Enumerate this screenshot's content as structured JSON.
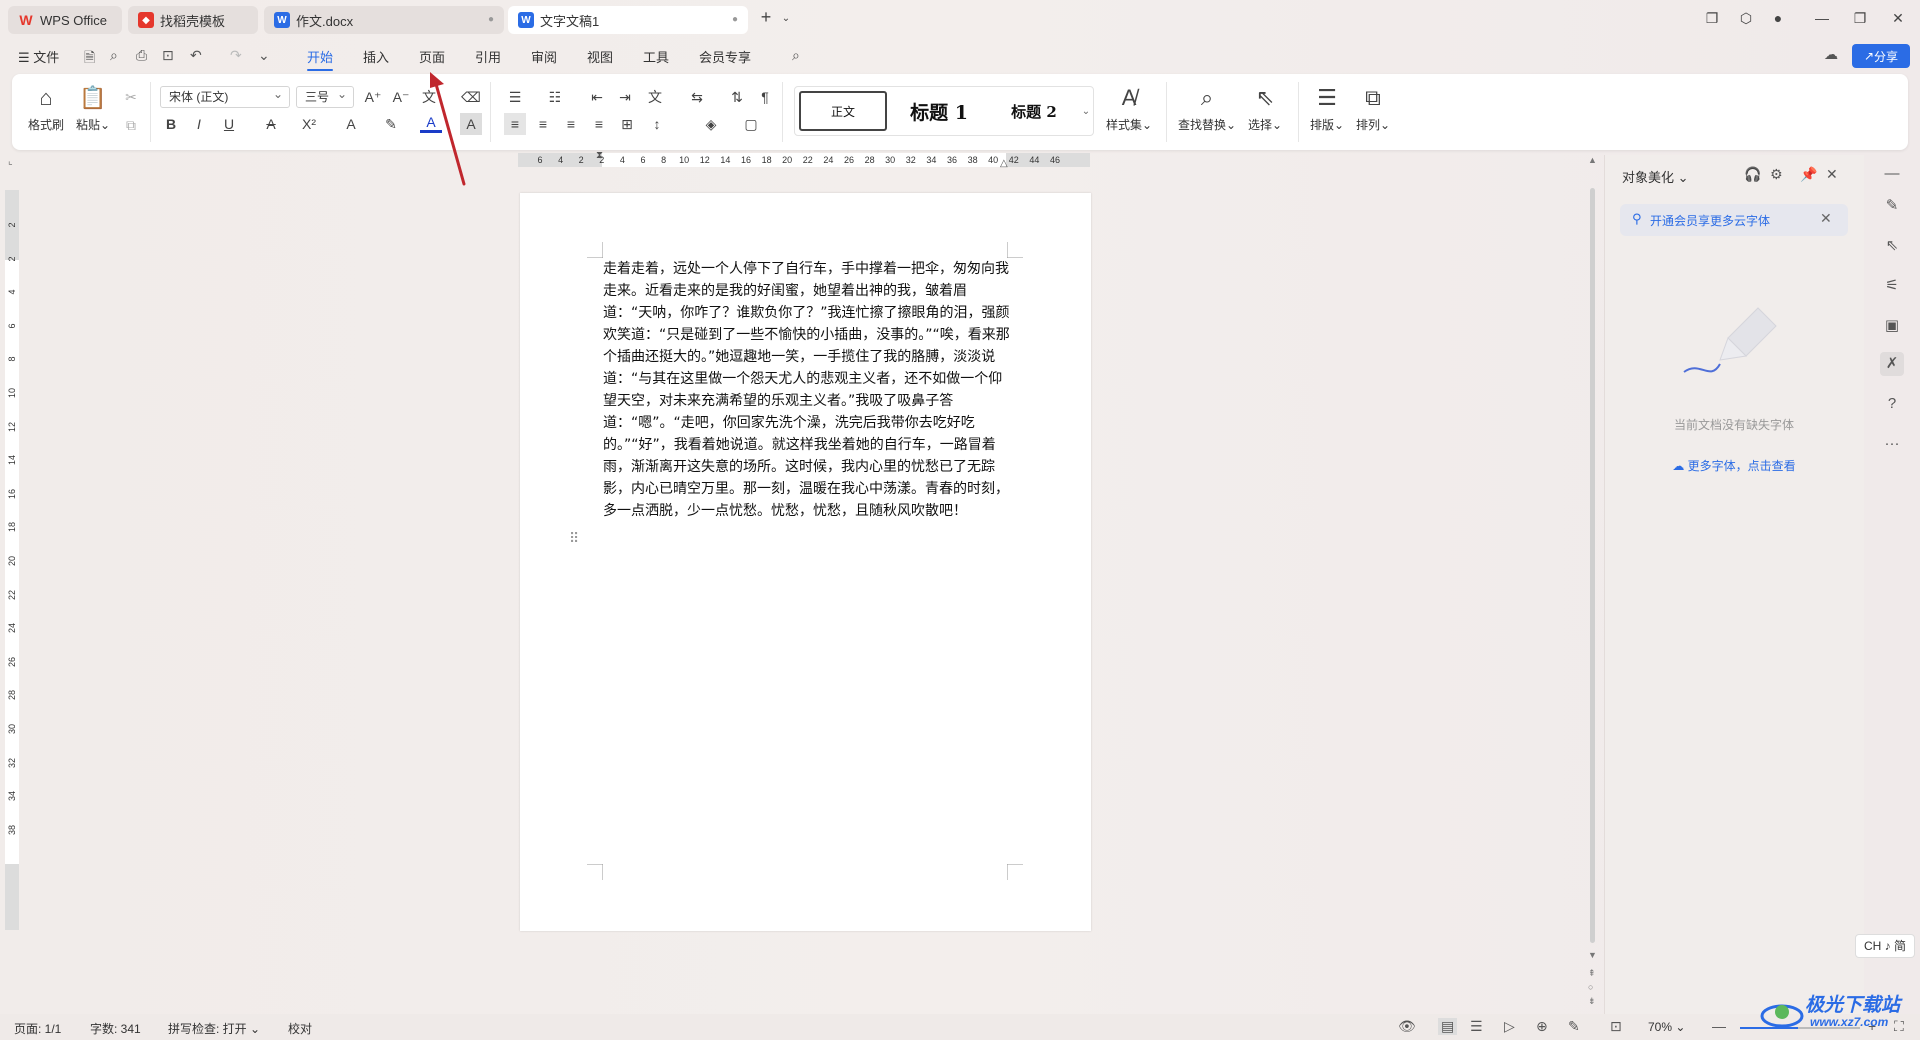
{
  "tabs": [
    {
      "label": "WPS Office",
      "icon": "wps-logo-icon",
      "color": "#e5372c"
    },
    {
      "label": "找稻壳模板",
      "icon": "docer-icon",
      "color": "#e5372c"
    },
    {
      "label": "作文.docx",
      "icon": "word-doc-icon",
      "color": "#2b6ce5"
    },
    {
      "label": "文字文稿1",
      "icon": "word-doc-icon",
      "color": "#2b6ce5"
    }
  ],
  "menu": {
    "file": "文件",
    "items": [
      "开始",
      "插入",
      "页面",
      "引用",
      "审阅",
      "视图",
      "工具",
      "会员专享"
    ],
    "active": "开始",
    "share": "分享"
  },
  "ribbon": {
    "format_painter": "格式刷",
    "paste": "粘贴",
    "font_name": "宋体 (正文)",
    "font_size": "三号",
    "styles": [
      "正文",
      "标题 1",
      "标题 2"
    ],
    "style_set": "样式集",
    "find_replace": "查找替换",
    "select": "选择",
    "layout": "排版",
    "arrange": "排列"
  },
  "ruler": {
    "h_ticks": [
      "6",
      "4",
      "2",
      "2",
      "4",
      "6",
      "8",
      "10",
      "12",
      "14",
      "16",
      "18",
      "20",
      "22",
      "24",
      "26",
      "28",
      "30",
      "32",
      "34",
      "36",
      "38",
      "40",
      "42",
      "44",
      "46"
    ],
    "v_ticks": [
      "2",
      "2",
      "4",
      "6",
      "8",
      "10",
      "12",
      "14",
      "16",
      "18",
      "20",
      "22",
      "24",
      "26",
      "28",
      "30",
      "32",
      "34",
      "38"
    ]
  },
  "document": {
    "paragraph": "走着走着，远处一个人停下了自行车，手中撑着一把伞，匆匆向我走来。近看走来的是我的好闺蜜，她望着出神的我，皱着眉道：“天呐，你咋了？谁欺负你了？”我连忙擦了擦眼角的泪，强颜欢笑道：“只是碰到了一些不愉快的小插曲，没事的。”“唉，看来那个插曲还挺大的。”她逗趣地一笑，一手揽住了我的胳膊，淡淡说道：“与其在这里做一个怨天尤人的悲观主义者，还不如做一个仰望天空，对未来充满希望的乐观主义者。”我吸了吸鼻子答道：“嗯”。“走吧，你回家先洗个澡，洗完后我带你去吃好吃的。”“好”，我看着她说道。就这样我坐着她的自行车，一路冒着雨，渐渐离开这失意的场所。这时候，我内心里的忧愁已了无踪影，内心已晴空万里。那一刻，温暖在我心中荡漾。青春的时刻，多一点洒脱，少一点忧愁。忧愁，忧愁，且随秋风吹散吧！"
  },
  "side_panel": {
    "title": "对象美化",
    "notice": "开通会员享更多云字体",
    "empty_text": "当前文档没有缺失字体",
    "more_fonts": "更多字体，点击查看"
  },
  "ime": "CH ♪ 简",
  "status": {
    "page": "页面: 1/1",
    "words": "字数: 341",
    "spell": "拼写检查: 打开",
    "proofread": "校对",
    "zoom": "70%",
    "zoom_fraction": 0.48
  },
  "watermark": {
    "text": "极光下载站",
    "sub": "www.xz7.com"
  },
  "colors": {
    "accent": "#2b6ce5",
    "arrow": "#c0272d"
  }
}
